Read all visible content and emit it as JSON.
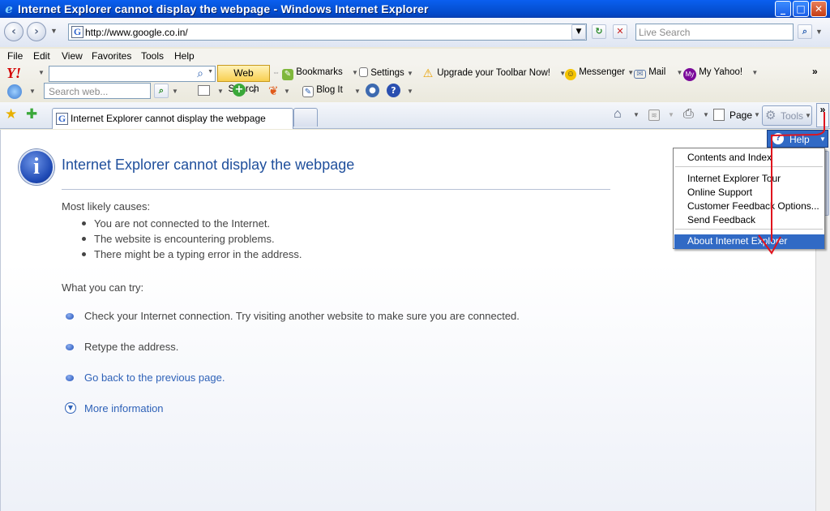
{
  "window": {
    "title": "Internet Explorer cannot display the webpage - Windows Internet Explorer",
    "buttons": {
      "minimize": "_",
      "maximize": "□",
      "close": "✕"
    }
  },
  "address_bar": {
    "url": "http://www.google.co.in/",
    "search_placeholder": "Live Search"
  },
  "menu_bar": {
    "items": [
      "File",
      "Edit",
      "View",
      "Favorites",
      "Tools",
      "Help"
    ]
  },
  "yahoo_toolbar": {
    "logo": "Y!",
    "web_search": "Web Search",
    "bookmarks": "Bookmarks",
    "settings": "Settings",
    "upgrade": "Upgrade your Toolbar Now!",
    "messenger": "Messenger",
    "mail": "Mail",
    "my_yahoo": "My Yahoo!",
    "search_placeholder": "Search web...",
    "blog_it": "Blog It"
  },
  "tab_row": {
    "tab_label": "Internet Explorer cannot display the webpage",
    "page_label": "Page",
    "tools_label": "Tools"
  },
  "content": {
    "heading": "Internet Explorer cannot display the webpage",
    "causes_title": "Most likely causes:",
    "causes": [
      "You are not connected to the Internet.",
      "The website is encountering problems.",
      "There might be a typing error in the address."
    ],
    "try_title": "What you can try:",
    "try_items": [
      "Check your Internet connection. Try visiting another website to make sure you are connected.",
      "Retype the address.",
      "Go back to the previous page."
    ],
    "more_info": "More information"
  },
  "help_menu": {
    "button_label": "Help",
    "items": [
      "Contents and Index",
      "Internet Explorer Tour",
      "Online Support",
      "Customer Feedback Options...",
      "Send Feedback",
      "About Internet Explorer"
    ],
    "selected_item": "About Internet Explorer"
  },
  "colors": {
    "titlebar": "#0a5ff0",
    "heading": "#1f4f9c",
    "menu_highlight": "#316ac5",
    "annotation": "#e0141e"
  }
}
